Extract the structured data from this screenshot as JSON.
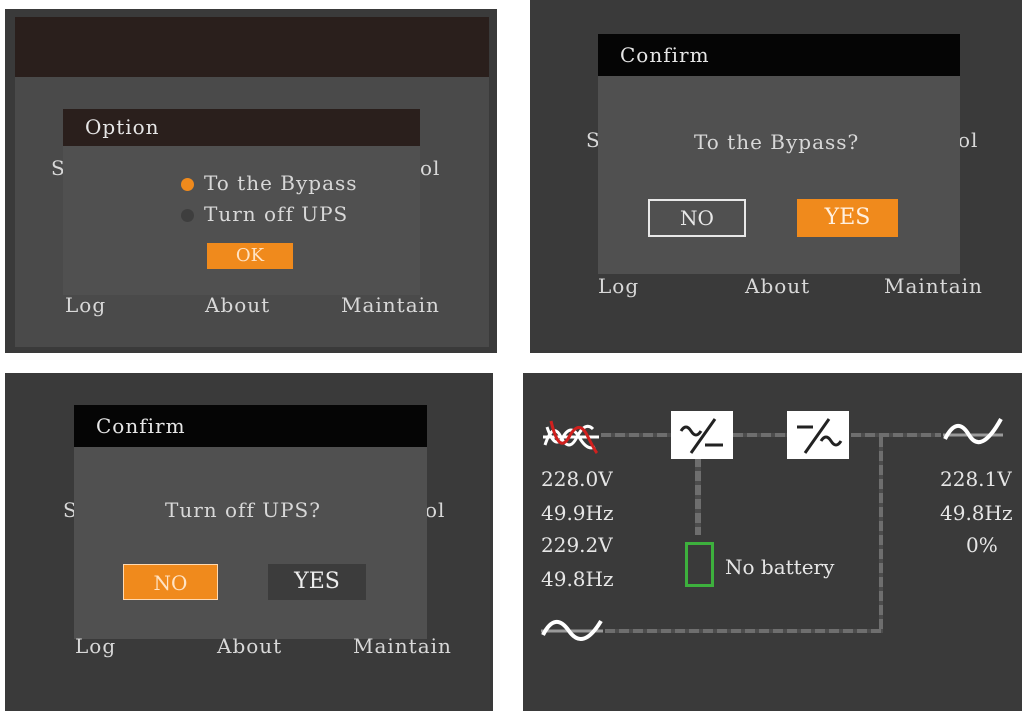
{
  "panel1": {
    "dialog_title": "Option",
    "options": [
      {
        "label": "To the Bypass",
        "selected": true
      },
      {
        "label": "Turn off UPS",
        "selected": false
      }
    ],
    "ok_label": "OK",
    "behind_left": "S",
    "behind_right": "ol",
    "menu": [
      "Log",
      "About",
      "Maintain"
    ]
  },
  "panel2": {
    "dialog_title": "Confirm",
    "message": "To the Bypass?",
    "no_label": "NO",
    "yes_label": "YES",
    "highlighted": "YES",
    "behind_left": "S",
    "behind_right": "ol",
    "menu": [
      "Log",
      "About",
      "Maintain"
    ]
  },
  "panel3": {
    "dialog_title": "Confirm",
    "message": "Turn off UPS?",
    "no_label": "NO",
    "yes_label": "YES",
    "highlighted": "NO",
    "behind_left": "S",
    "behind_right": "ol",
    "menu": [
      "Log",
      "About",
      "Maintain"
    ]
  },
  "panel4": {
    "input": {
      "voltage1": "228.0V",
      "freq1": "49.9Hz",
      "voltage2": "229.2V",
      "freq2": "49.8Hz"
    },
    "output": {
      "voltage": "228.1V",
      "freq": "49.8Hz",
      "load": "0%"
    },
    "battery_status": "No battery",
    "icons": [
      "mains-input-fault-icon",
      "rectifier-icon",
      "inverter-icon",
      "output-sine-icon",
      "bypass-sine-icon",
      "battery-icon"
    ]
  },
  "colors": {
    "accent": "#f08a1c",
    "fault": "#d0201e",
    "battery": "#3db03d"
  }
}
